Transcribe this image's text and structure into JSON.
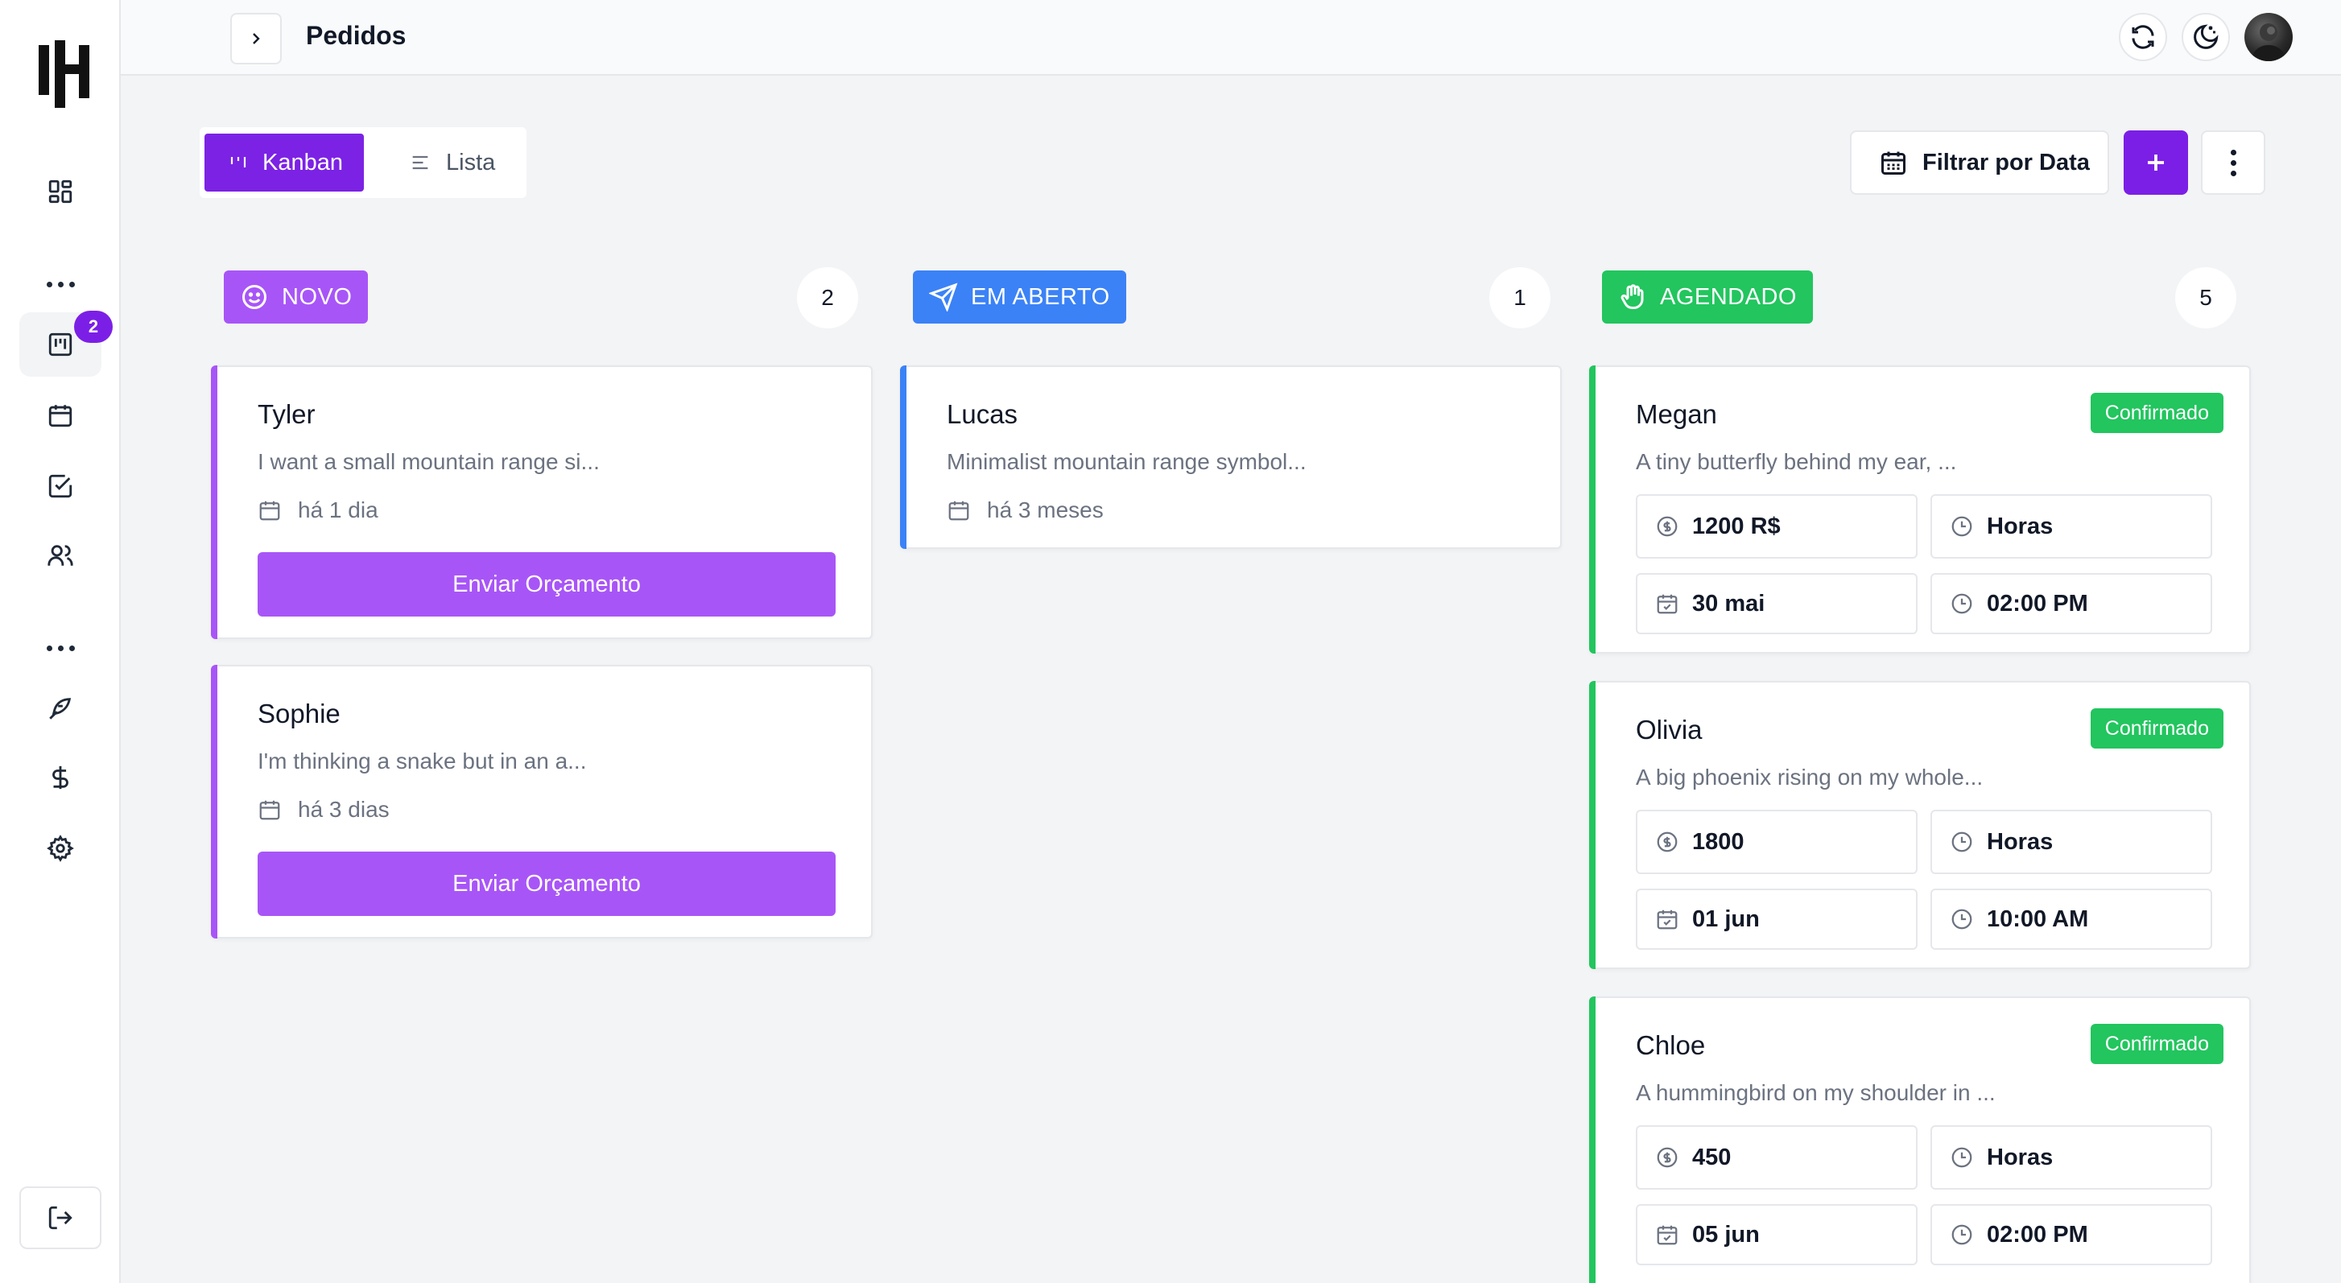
{
  "header": {
    "title": "Pedidos"
  },
  "sidebar": {
    "badge": "2"
  },
  "toolbar": {
    "kanban_label": "Kanban",
    "lista_label": "Lista",
    "filter_label": "Filtrar por Data"
  },
  "colors": {
    "brand": "#7c1fe6",
    "novo": "#a855f7",
    "em_aberto": "#3b82f6",
    "agendado": "#22c55e"
  },
  "columns": [
    {
      "label": "NOVO",
      "count": "2",
      "icon": "smile-icon",
      "cards": [
        {
          "name": "Tyler",
          "description": "I want a small mountain range si...",
          "date": "há 1 dia",
          "action": "Enviar Orçamento"
        },
        {
          "name": "Sophie",
          "description": "I'm thinking a snake but in an a...",
          "date": "há 3 dias",
          "action": "Enviar Orçamento"
        }
      ]
    },
    {
      "label": "EM ABERTO",
      "count": "1",
      "icon": "send-icon",
      "cards": [
        {
          "name": "Lucas",
          "description": "Minimalist mountain range symbol...",
          "date": "há 3 meses"
        }
      ]
    },
    {
      "label": "AGENDADO",
      "count": "5",
      "icon": "hand-icon",
      "cards": [
        {
          "name": "Megan",
          "status": "Confirmado",
          "description": "A tiny butterfly behind my ear, ...",
          "price": "1200 R$",
          "duration": "Horas",
          "date": "30 mai",
          "time": "02:00 PM"
        },
        {
          "name": "Olivia",
          "status": "Confirmado",
          "description": "A big phoenix rising on my whole...",
          "price": "1800",
          "duration": "Horas",
          "date": "01 jun",
          "time": "10:00 AM"
        },
        {
          "name": "Chloe",
          "status": "Confirmado",
          "description": "A hummingbird on my shoulder in ...",
          "price": "450",
          "duration": "Horas",
          "date": "05 jun",
          "time": "02:00 PM"
        }
      ]
    }
  ]
}
